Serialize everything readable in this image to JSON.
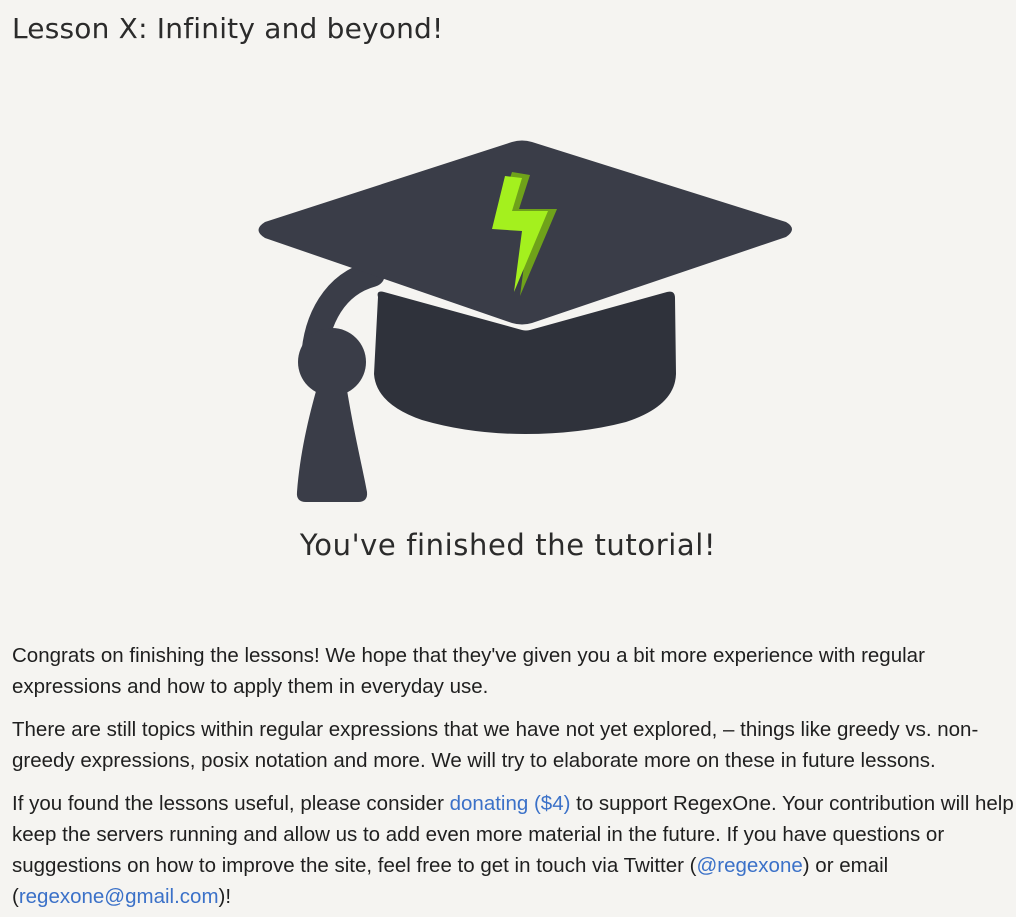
{
  "lesson": {
    "title": "Lesson X: Infinity and beyond!"
  },
  "illustration": {
    "icon": "graduation-cap-icon",
    "cap_color": "#3a3d48",
    "bolt_color": "#a4f01e"
  },
  "finished_heading": "You've finished the tutorial!",
  "paragraphs": {
    "p1": "Congrats on finishing the lessons! We hope that they've given you a bit more experience with regular expressions and how to apply them in everyday use.",
    "p2": "There are still topics within regular expressions that we have not yet explored, – things like greedy vs. non-greedy expressions, posix notation and more. We will try to elaborate more on these in future lessons.",
    "p3_part1": "If you found the lessons useful, please consider ",
    "p3_link_donate": "donating ($4)",
    "p3_part2": " to support RegexOne. Your contribution will help keep the servers running and allow us to add even more material in the future. If you have questions or suggestions on how to improve the site, feel free to get in touch via Twitter (",
    "p3_link_twitter": "@regexone",
    "p3_part3": ") or email (",
    "p3_link_email": "regexone@gmail.com",
    "p3_part4": ")!"
  },
  "colors": {
    "link": "#3b71c8",
    "background": "#f5f4f1"
  }
}
